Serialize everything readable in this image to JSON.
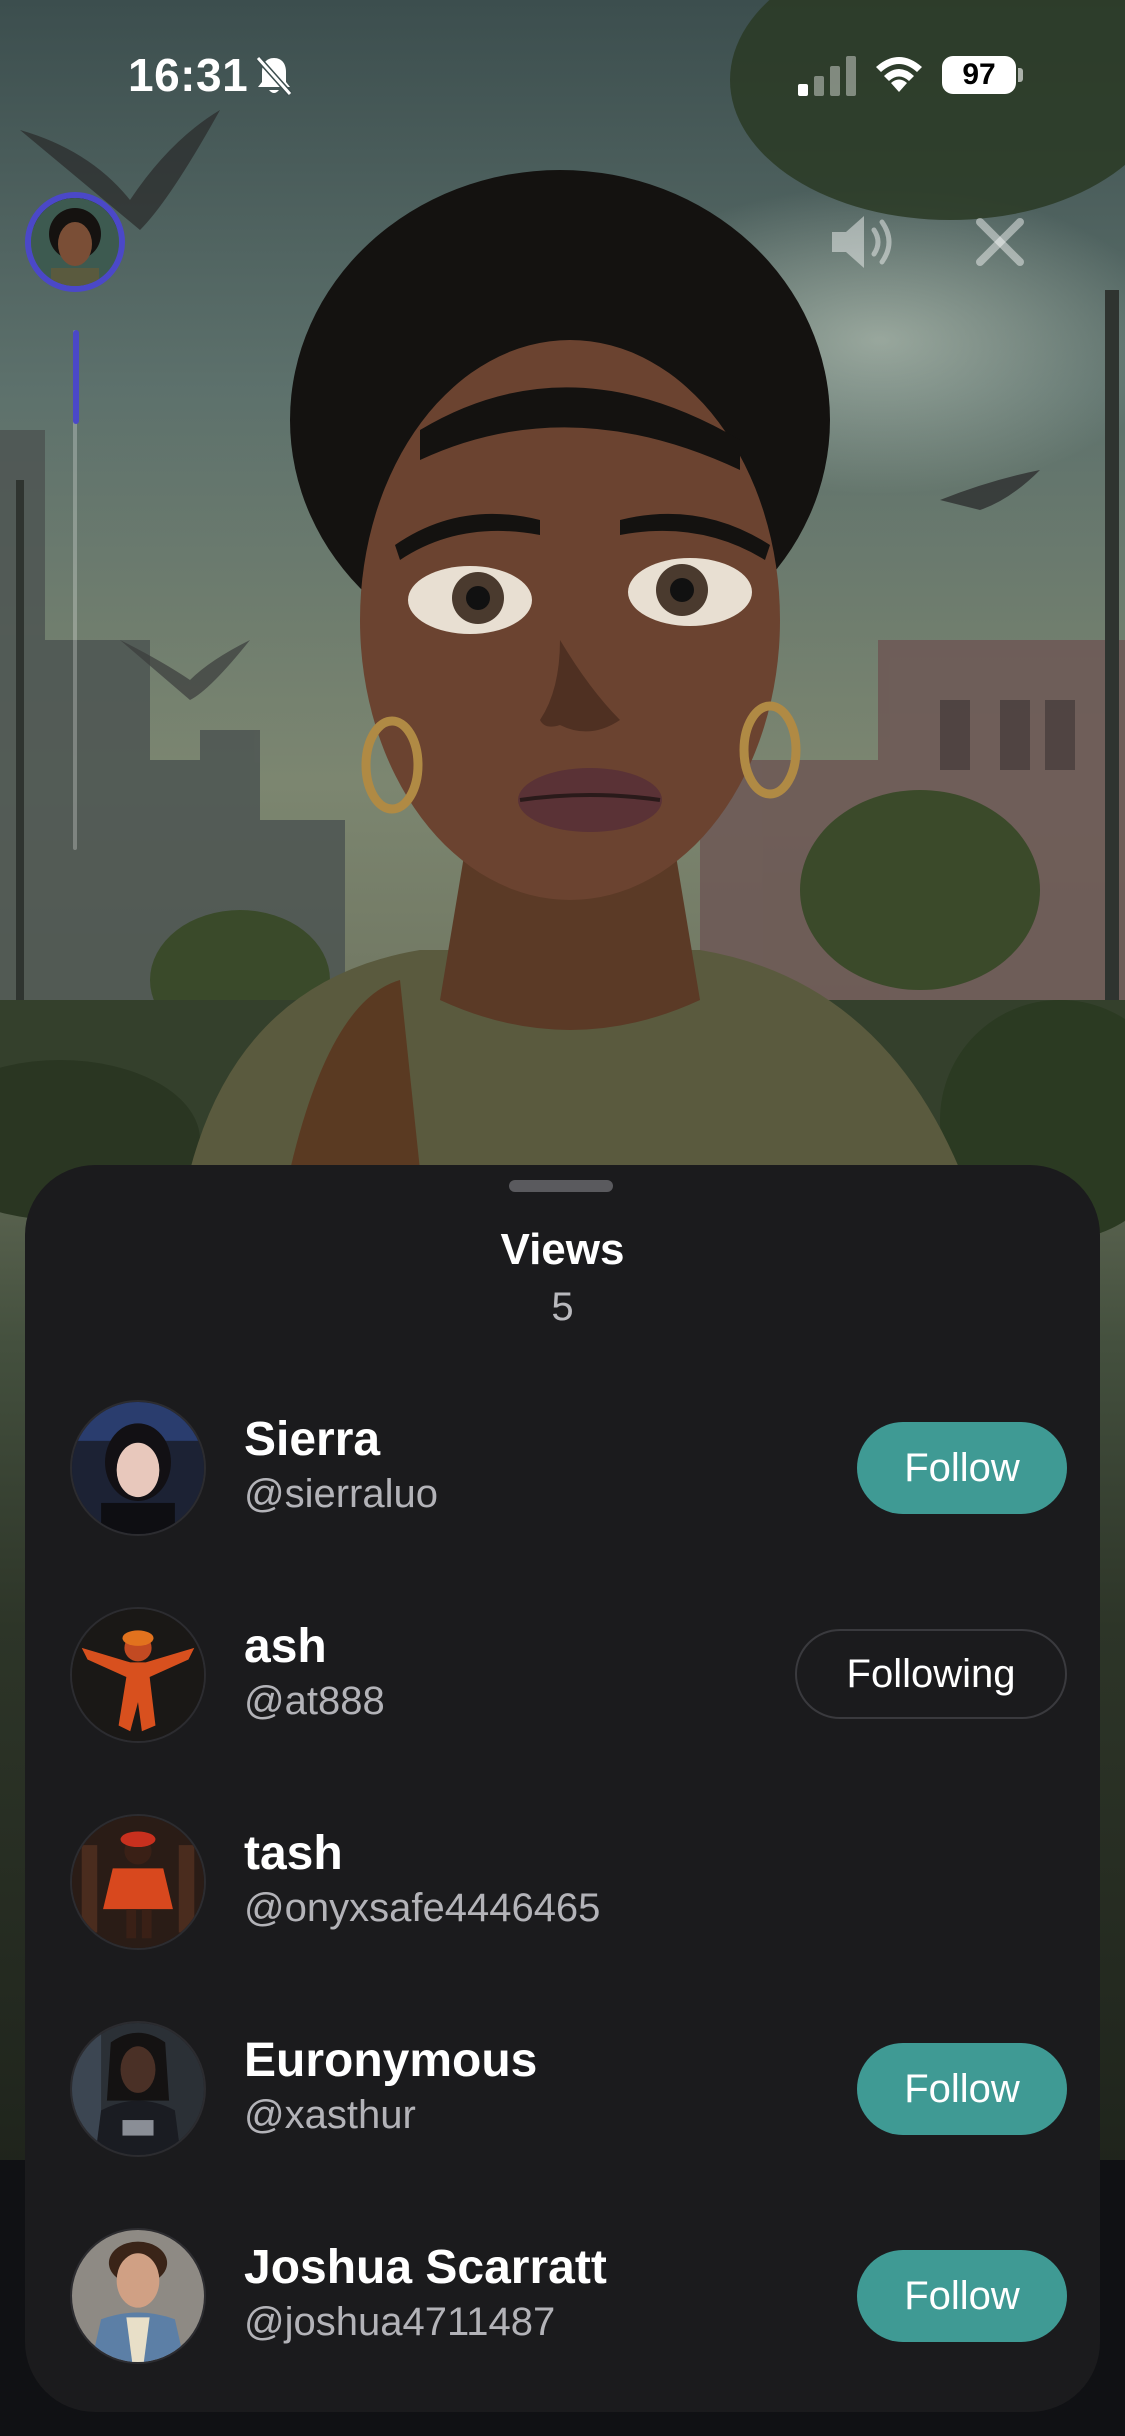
{
  "status_bar": {
    "time": "16:31",
    "battery": "97",
    "icons": [
      "bell-slash-icon",
      "signal-icon",
      "wifi-icon",
      "battery-icon"
    ]
  },
  "story": {
    "icons": [
      "mute-icon",
      "close-icon"
    ],
    "progress": 0.18
  },
  "sheet": {
    "title": "Views",
    "count": "5",
    "viewers": [
      {
        "name": "Sierra",
        "handle": "@sierraluo",
        "button": "Follow"
      },
      {
        "name": "ash",
        "handle": "@at888",
        "button": "Following"
      },
      {
        "name": "tash",
        "handle": "@onyxsafe4446465",
        "button": ""
      },
      {
        "name": "Euronymous",
        "handle": "@xasthur",
        "button": "Follow"
      },
      {
        "name": "Joshua Scarratt",
        "handle": "@joshua4711487",
        "button": "Follow"
      }
    ]
  },
  "colors": {
    "accent": "#4b48c8",
    "follow_button": "#3f9a94",
    "sheet_bg": "#1b1b1d"
  }
}
